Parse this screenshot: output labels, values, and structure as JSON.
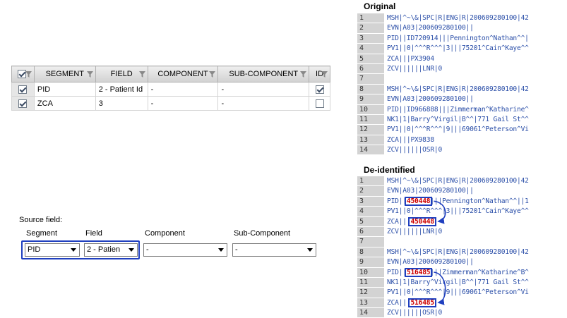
{
  "grid": {
    "columns": [
      "SEGMENT",
      "FIELD",
      "COMPONENT",
      "SUB-COMPONENT",
      "ID"
    ],
    "rows": [
      {
        "selected": true,
        "segment": "PID",
        "field": "2 - Patient Id",
        "component": "-",
        "sub_component": "-",
        "id": true
      },
      {
        "selected": true,
        "segment": "ZCA",
        "field": "3",
        "component": "-",
        "sub_component": "-",
        "id": false
      }
    ]
  },
  "source": {
    "title": "Source field:",
    "segment_label": "Segment",
    "field_label": "Field",
    "component_label": "Component",
    "subcomponent_label": "Sub-Component",
    "segment_value": "PID",
    "field_value": "2 - Patien",
    "component_value": "-",
    "subcomponent_value": "-"
  },
  "original": {
    "title": "Original",
    "lines": [
      {
        "n": "1",
        "text": "MSH|^~\\&|SPC|R|ENG|R|200609280100|42"
      },
      {
        "n": "2",
        "text": "EVN|A03|200609280100||"
      },
      {
        "n": "3",
        "text": "PID||ID720914|||Pennington^Nathan^^|"
      },
      {
        "n": "4",
        "text": "PV1||0|^^^R^^^|3|||75201^Cain^Kaye^^"
      },
      {
        "n": "5",
        "text": "ZCA|||PX3904"
      },
      {
        "n": "6",
        "text": "ZCV||||||LNR|0"
      },
      {
        "n": "7",
        "text": ""
      },
      {
        "n": "8",
        "text": "MSH|^~\\&|SPC|R|ENG|R|200609280100|42"
      },
      {
        "n": "9",
        "text": "EVN|A03|200609280100||"
      },
      {
        "n": "10",
        "text": "PID||ID966888|||Zimmerman^Katharine^"
      },
      {
        "n": "11",
        "text": "NK1|1|Barry^Virgil|B^^|771 Gail St^^"
      },
      {
        "n": "12",
        "text": "PV1||0|^^^R^^^|9|||69061^Peterson^Vi"
      },
      {
        "n": "13",
        "text": "ZCA|||PX9838"
      },
      {
        "n": "14",
        "text": "ZCV||||||OSR|0"
      }
    ]
  },
  "deidentified": {
    "title": "De-identified",
    "lines": [
      {
        "n": "1",
        "pre": "MSH|^~\\&|SPC|R|ENG|R|200609280100|42",
        "hl": "",
        "post": ""
      },
      {
        "n": "2",
        "pre": "EVN|A03|200609280100||",
        "hl": "",
        "post": ""
      },
      {
        "n": "3",
        "pre": "PID||",
        "hl": "450448",
        "post": "|||Pennington^Nathan^^||1"
      },
      {
        "n": "4",
        "pre": "PV1||0|^^^R^^^|3|||75201^Cain^Kaye^^",
        "hl": "",
        "post": ""
      },
      {
        "n": "5",
        "pre": "ZCA|||",
        "hl": "450448",
        "post": ""
      },
      {
        "n": "6",
        "pre": "ZCV||||||LNR|0",
        "hl": "",
        "post": ""
      },
      {
        "n": "7",
        "pre": "",
        "hl": "",
        "post": ""
      },
      {
        "n": "8",
        "pre": "MSH|^~\\&|SPC|R|ENG|R|200609280100|42",
        "hl": "",
        "post": ""
      },
      {
        "n": "9",
        "pre": "EVN|A03|200609280100||",
        "hl": "",
        "post": ""
      },
      {
        "n": "10",
        "pre": "PID||",
        "hl": "516485",
        "post": "|||Zimmerman^Katharine^B^"
      },
      {
        "n": "11",
        "pre": "NK1|1|Barry^Virgil|B^^|771 Gail St^^",
        "hl": "",
        "post": ""
      },
      {
        "n": "12",
        "pre": "PV1||0|^^^R^^^|9|||69061^Peterson^Vi",
        "hl": "",
        "post": ""
      },
      {
        "n": "13",
        "pre": "ZCA|||",
        "hl": "516485",
        "post": ""
      },
      {
        "n": "14",
        "pre": "ZCV||||||OSR|0",
        "hl": "",
        "post": ""
      }
    ]
  },
  "colors": {
    "highlight_border": "#1f3fbf",
    "replaced_value": "#cc0000",
    "code_text": "#2a4ea8"
  }
}
